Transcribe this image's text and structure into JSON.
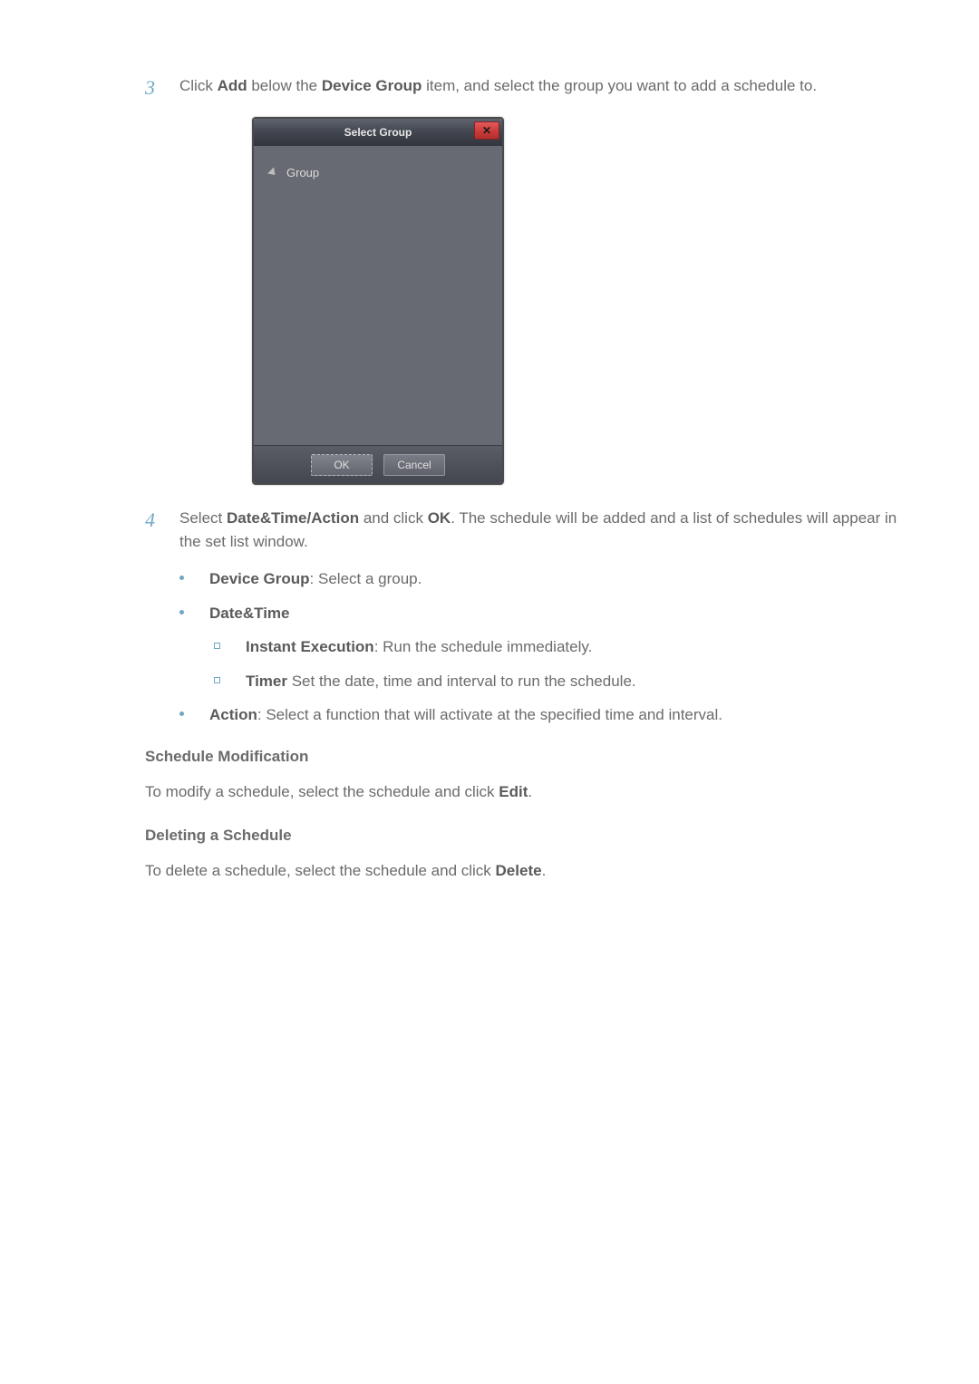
{
  "step3": {
    "num": "3",
    "pre": "Click ",
    "add": "Add",
    "mid1": " below the ",
    "dg": "Device Group",
    "post": " item, and select the group you want to add a schedule to."
  },
  "dialog": {
    "title": "Select Group",
    "tree_item": "Group",
    "ok": "OK",
    "cancel": "Cancel"
  },
  "step4": {
    "num": "4",
    "pre": "Select ",
    "dta": "Date&Time/Action",
    "mid1": " and click ",
    "ok": "OK",
    "post": ". The schedule will be added and a list of schedules will appear in the set list window."
  },
  "bullets": {
    "b1_bold": "Device Group",
    "b1_text": ": Select a group.",
    "b2_bold": "Date&Time",
    "s1_bold": "Instant Execution",
    "s1_text": ": Run the schedule immediately.",
    "s2_bold": "Timer",
    "s2_text": " Set the date, time and interval to run the schedule.",
    "b3_bold": "Action",
    "b3_text": ": Select a function that will activate at the specified time and interval."
  },
  "mod": {
    "heading": "Schedule Modification",
    "pre": "To modify a schedule, select the schedule and click ",
    "edit": "Edit",
    "post": "."
  },
  "del": {
    "heading": "Deleting a Schedule",
    "pre": "To delete a schedule, select the schedule and click ",
    "delete": "Delete",
    "post": "."
  }
}
